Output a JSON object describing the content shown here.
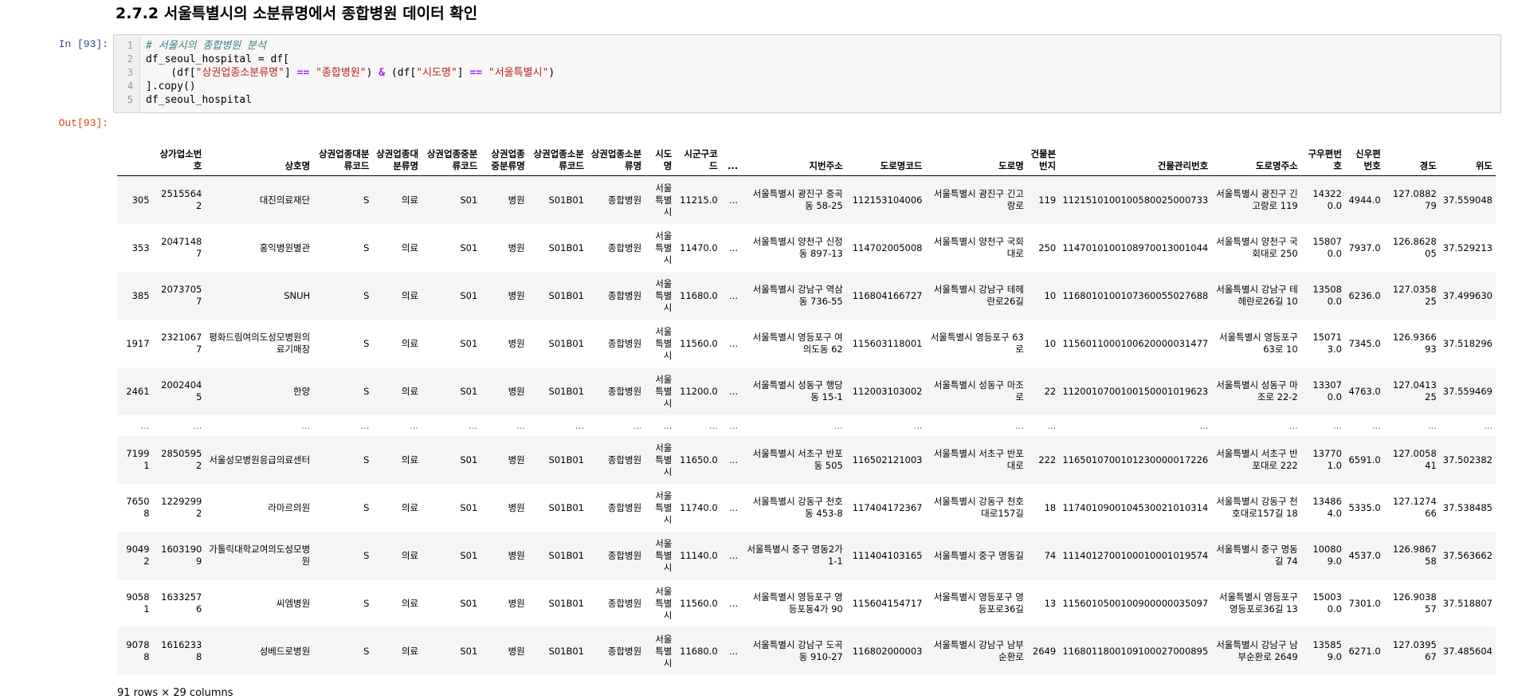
{
  "heading": "2.7.2 서울특별시의 소분류명에서 종합병원 데이터 확인",
  "in_prompt": "In [93]:",
  "out_prompt": "Out[93]:",
  "code_lines": [
    "# 서울시의 종합병원 분석",
    "df_seoul_hospital = df[",
    "    (df[\"상권업종소분류명\"] == \"종합병원\") & (df[\"시도명\"] == \"서울특별시\")",
    "].copy()",
    "df_seoul_hospital"
  ],
  "line_numbers": [
    "1",
    "2",
    "3",
    "4",
    "5"
  ],
  "columns": [
    "",
    "상가업소번호",
    "상호명",
    "상권업종대분류코드",
    "상권업종대분류명",
    "상권업종중분류코드",
    "상권업종중분류명",
    "상권업종소분류코드",
    "상권업종소분류명",
    "시도명",
    "시군구코드",
    "...",
    "지번주소",
    "도로명코드",
    "도로명",
    "건물본번지",
    "건물관리번호",
    "도로명주소",
    "구우편번호",
    "신우편번호",
    "경도",
    "위도"
  ],
  "rows": [
    [
      "305",
      "25155642",
      "대진의료재단",
      "S",
      "의료",
      "S01",
      "병원",
      "S01B01",
      "종합병원",
      "서울특별시",
      "11215.0",
      "...",
      "서울특별시 광진구 중곡동 58-25",
      "112153104006",
      "서울특별시 광진구 긴고랑로",
      "119",
      "1121510100100580025000733",
      "서울특별시 광진구 긴고랑로 119",
      "143220.0",
      "4944.0",
      "127.088279",
      "37.559048"
    ],
    [
      "353",
      "20471487",
      "홍익병원별관",
      "S",
      "의료",
      "S01",
      "병원",
      "S01B01",
      "종합병원",
      "서울특별시",
      "11470.0",
      "...",
      "서울특별시 양천구 신정동 897-13",
      "114702005008",
      "서울특별시 양천구 국회대로",
      "250",
      "1147010100108970013001044",
      "서울특별시 양천구 국회대로 250",
      "158070.0",
      "7937.0",
      "126.862805",
      "37.529213"
    ],
    [
      "385",
      "20737057",
      "SNUH",
      "S",
      "의료",
      "S01",
      "병원",
      "S01B01",
      "종합병원",
      "서울특별시",
      "11680.0",
      "...",
      "서울특별시 강남구 역삼동 736-55",
      "116804166727",
      "서울특별시 강남구 테헤란로26길",
      "10",
      "1168010100107360055027688",
      "서울특별시 강남구 테헤란로26길 10",
      "135080.0",
      "6236.0",
      "127.035825",
      "37.499630"
    ],
    [
      "1917",
      "23210677",
      "평화드림여의도성모병원의료기매장",
      "S",
      "의료",
      "S01",
      "병원",
      "S01B01",
      "종합병원",
      "서울특별시",
      "11560.0",
      "...",
      "서울특별시 영등포구 여의도동 62",
      "115603118001",
      "서울특별시 영등포구 63로",
      "10",
      "1156011000100620000031477",
      "서울특별시 영등포구 63로 10",
      "150713.0",
      "7345.0",
      "126.936693",
      "37.518296"
    ],
    [
      "2461",
      "20024045",
      "한양",
      "S",
      "의료",
      "S01",
      "병원",
      "S01B01",
      "종합병원",
      "서울특별시",
      "11200.0",
      "...",
      "서울특별시 성동구 행당동 15-1",
      "112003103002",
      "서울특별시 성동구 마조로",
      "22",
      "1120010700100150001019623",
      "서울특별시 성동구 마조로 22-2",
      "133070.0",
      "4763.0",
      "127.041325",
      "37.559469"
    ],
    [
      "...",
      "...",
      "...",
      "...",
      "...",
      "...",
      "...",
      "...",
      "...",
      "...",
      "...",
      "...",
      "...",
      "...",
      "...",
      "...",
      "...",
      "...",
      "...",
      "...",
      "...",
      "..."
    ],
    [
      "71991",
      "28505952",
      "서울성모병원응급의료센터",
      "S",
      "의료",
      "S01",
      "병원",
      "S01B01",
      "종합병원",
      "서울특별시",
      "11650.0",
      "...",
      "서울특별시 서초구 반포동 505",
      "116502121003",
      "서울특별시 서초구 반포대로",
      "222",
      "1165010700101230000017226",
      "서울특별시 서초구 반포대로 222",
      "137701.0",
      "6591.0",
      "127.005841",
      "37.502382"
    ],
    [
      "76508",
      "12292992",
      "라마르의원",
      "S",
      "의료",
      "S01",
      "병원",
      "S01B01",
      "종합병원",
      "서울특별시",
      "11740.0",
      "...",
      "서울특별시 강동구 천호동 453-8",
      "117404172367",
      "서울특별시 강동구 천호대로157길",
      "18",
      "1174010900104530021010314",
      "서울특별시 강동구 천호대로157길 18",
      "134864.0",
      "5335.0",
      "127.127466",
      "37.538485"
    ],
    [
      "90492",
      "16031909",
      "가톨릭대학교여의도성모병원",
      "S",
      "의료",
      "S01",
      "병원",
      "S01B01",
      "종합병원",
      "서울특별시",
      "11140.0",
      "...",
      "서울특별시 중구 명동2가 1-1",
      "111404103165",
      "서울특별시 중구 명동길",
      "74",
      "1114012700100010001019574",
      "서울특별시 중구 명동길 74",
      "100809.0",
      "4537.0",
      "126.986758",
      "37.563662"
    ],
    [
      "90581",
      "16332576",
      "씨엠병원",
      "S",
      "의료",
      "S01",
      "병원",
      "S01B01",
      "종합병원",
      "서울특별시",
      "11560.0",
      "...",
      "서울특별시 영등포구 영등포동4가 90",
      "115604154717",
      "서울특별시 영등포구 영등포로36길",
      "13",
      "1156010500100900000035097",
      "서울특별시 영등포구 영등포로36길 13",
      "150030.0",
      "7301.0",
      "126.903857",
      "37.518807"
    ],
    [
      "90788",
      "16162338",
      "성베드로병원",
      "S",
      "의료",
      "S01",
      "병원",
      "S01B01",
      "종합병원",
      "서울특별시",
      "11680.0",
      "...",
      "서울특별시 강남구 도곡동 910-27",
      "116802000003",
      "서울특별시 강남구 남부순환로",
      "2649",
      "1168011800109100027000895",
      "서울특별시 강남구 남부순환로 2649",
      "135859.0",
      "6271.0",
      "127.039567",
      "37.485604"
    ]
  ],
  "footer": "91 rows × 29 columns"
}
